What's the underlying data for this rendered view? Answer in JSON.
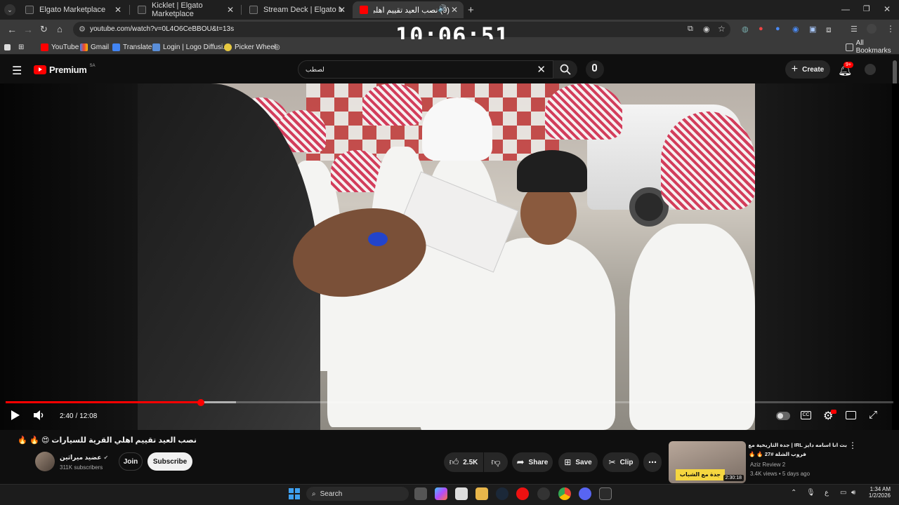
{
  "browser": {
    "tabs": [
      {
        "title": "Elgato Marketplace",
        "active": false
      },
      {
        "title": "Kicklet | Elgato Marketplace",
        "active": false
      },
      {
        "title": "Stream Deck | Elgato Marketpl",
        "active": false
      },
      {
        "title": "(9) نصب العيد تقييم اهلي ال",
        "active": true
      }
    ],
    "url": "youtube.com/watch?v=0L4O6CeBBOU&t=13s",
    "bookmarks": [
      "YouTube",
      "Gmail",
      "Translate",
      "Login | Logo Diffusi...",
      "Picker Wheel"
    ],
    "all_bookmarks": "All Bookmarks"
  },
  "overlay_clock": "10:06:51",
  "youtube": {
    "logo": "Premium",
    "logo_region": "SA",
    "search_value": "لصطب",
    "create_label": "Create",
    "notifications_badge": "9+"
  },
  "player": {
    "time_current": "2:40",
    "time_separator": "/",
    "time_total": "12:08",
    "progress_fraction": 0.22
  },
  "video": {
    "title": "نصب العيد تقييم اهلي القرية للسيارات 😍 🔥 🔥",
    "channel": "عضيد ميراثين",
    "subscribers": "311K subscribers",
    "join_label": "Join",
    "subscribe_label": "Subscribe",
    "likes": "2.5K",
    "share_label": "Share",
    "save_label": "Save",
    "clip_label": "Clip"
  },
  "recommended": {
    "title_line1": "بث انا اسامه دايز IRL | جدة الثاريخية مع",
    "title_line2": "فروب الشلة #27 🔥 🔥",
    "channel": "Aziz Review 2",
    "meta": "3.4K views • 5 days ago",
    "duration": "2:30:18",
    "thumb_text": "جدة مع الشباب"
  },
  "taskbar": {
    "search_label": "Search",
    "time": "1:34 AM",
    "date": "1/2/2026",
    "lang": "ع"
  },
  "colors": {
    "youtube_red": "#ff0000",
    "background": "#0f0f0f",
    "chrome_dark": "#3a3a3a"
  }
}
